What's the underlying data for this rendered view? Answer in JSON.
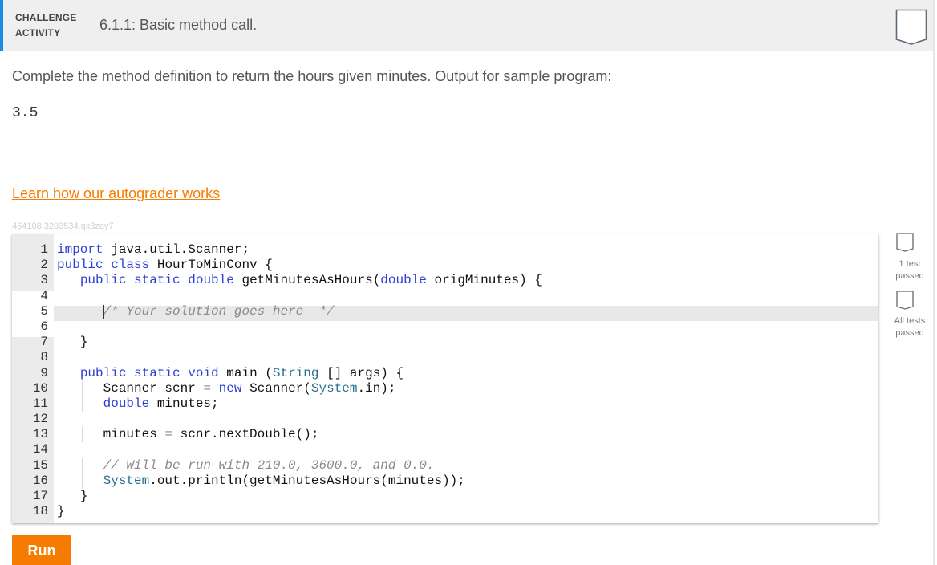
{
  "header": {
    "activity_type_line1": "CHALLENGE",
    "activity_type_line2": "ACTIVITY",
    "title": "6.1.1: Basic method call.",
    "accent_color": "#1e88e5"
  },
  "prompt": "Complete the method definition to return the hours given minutes. Output for sample program:",
  "sample_output": "3.5",
  "learn_link": "Learn how our autograder works",
  "challenge_id": "464108.3203534.qx3zqy7",
  "editor": {
    "lines": [
      {
        "n": "1",
        "tokens": [
          {
            "t": "import",
            "c": "kw"
          },
          {
            "t": " java.util.Scanner;",
            "c": ""
          }
        ]
      },
      {
        "n": "2",
        "tokens": [
          {
            "t": "public",
            "c": "kw"
          },
          {
            "t": " ",
            "c": ""
          },
          {
            "t": "class",
            "c": "kw"
          },
          {
            "t": " HourToMinConv {",
            "c": ""
          }
        ]
      },
      {
        "n": "3",
        "tokens": [
          {
            "t": "   ",
            "c": ""
          },
          {
            "t": "public",
            "c": "kw"
          },
          {
            "t": " ",
            "c": ""
          },
          {
            "t": "static",
            "c": "kw"
          },
          {
            "t": " ",
            "c": ""
          },
          {
            "t": "double",
            "c": "kw"
          },
          {
            "t": " getMinutesAsHours(",
            "c": ""
          },
          {
            "t": "double",
            "c": "kw"
          },
          {
            "t": " origMinutes) {",
            "c": ""
          }
        ]
      },
      {
        "n": "4",
        "tokens": []
      },
      {
        "n": "5",
        "tokens": [
          {
            "t": "      ",
            "c": ""
          },
          {
            "t": "/* Your solution goes here  */",
            "c": "cm"
          }
        ]
      },
      {
        "n": "6",
        "tokens": []
      },
      {
        "n": "7",
        "tokens": [
          {
            "t": "   }",
            "c": ""
          }
        ]
      },
      {
        "n": "8",
        "tokens": []
      },
      {
        "n": "9",
        "tokens": [
          {
            "t": "   ",
            "c": ""
          },
          {
            "t": "public",
            "c": "kw"
          },
          {
            "t": " ",
            "c": ""
          },
          {
            "t": "static",
            "c": "kw"
          },
          {
            "t": " ",
            "c": ""
          },
          {
            "t": "void",
            "c": "kw"
          },
          {
            "t": " main (",
            "c": ""
          },
          {
            "t": "String",
            "c": "ty"
          },
          {
            "t": " [] args) {",
            "c": ""
          }
        ]
      },
      {
        "n": "10",
        "tokens": [
          {
            "t": "      Scanner scnr ",
            "c": ""
          },
          {
            "t": "=",
            "c": "op"
          },
          {
            "t": " ",
            "c": ""
          },
          {
            "t": "new",
            "c": "kw"
          },
          {
            "t": " Scanner(",
            "c": ""
          },
          {
            "t": "System",
            "c": "ty"
          },
          {
            "t": ".in);",
            "c": ""
          }
        ]
      },
      {
        "n": "11",
        "tokens": [
          {
            "t": "      ",
            "c": ""
          },
          {
            "t": "double",
            "c": "kw"
          },
          {
            "t": " minutes;",
            "c": ""
          }
        ]
      },
      {
        "n": "12",
        "tokens": []
      },
      {
        "n": "13",
        "tokens": [
          {
            "t": "      minutes ",
            "c": ""
          },
          {
            "t": "=",
            "c": "op"
          },
          {
            "t": " scnr.nextDouble();",
            "c": ""
          }
        ]
      },
      {
        "n": "14",
        "tokens": []
      },
      {
        "n": "15",
        "tokens": [
          {
            "t": "      ",
            "c": ""
          },
          {
            "t": "// Will be run with 210.0, 3600.0, and 0.0.",
            "c": "cm"
          }
        ]
      },
      {
        "n": "16",
        "tokens": [
          {
            "t": "      ",
            "c": ""
          },
          {
            "t": "System",
            "c": "ty"
          },
          {
            "t": ".out.println(getMinutesAsHours(minutes));",
            "c": ""
          }
        ]
      },
      {
        "n": "17",
        "tokens": [
          {
            "t": "   }",
            "c": ""
          }
        ]
      },
      {
        "n": "18",
        "tokens": [
          {
            "t": "}",
            "c": ""
          }
        ]
      }
    ]
  },
  "status": {
    "one_test_line1": "1 test",
    "one_test_line2": "passed",
    "all_tests_line1": "All tests",
    "all_tests_line2": "passed"
  },
  "run_button": "Run",
  "colors": {
    "accent_orange": "#f57c00",
    "keyword": "#2b3fd6",
    "type": "#2b6f8f",
    "comment": "#8a8a8a"
  }
}
